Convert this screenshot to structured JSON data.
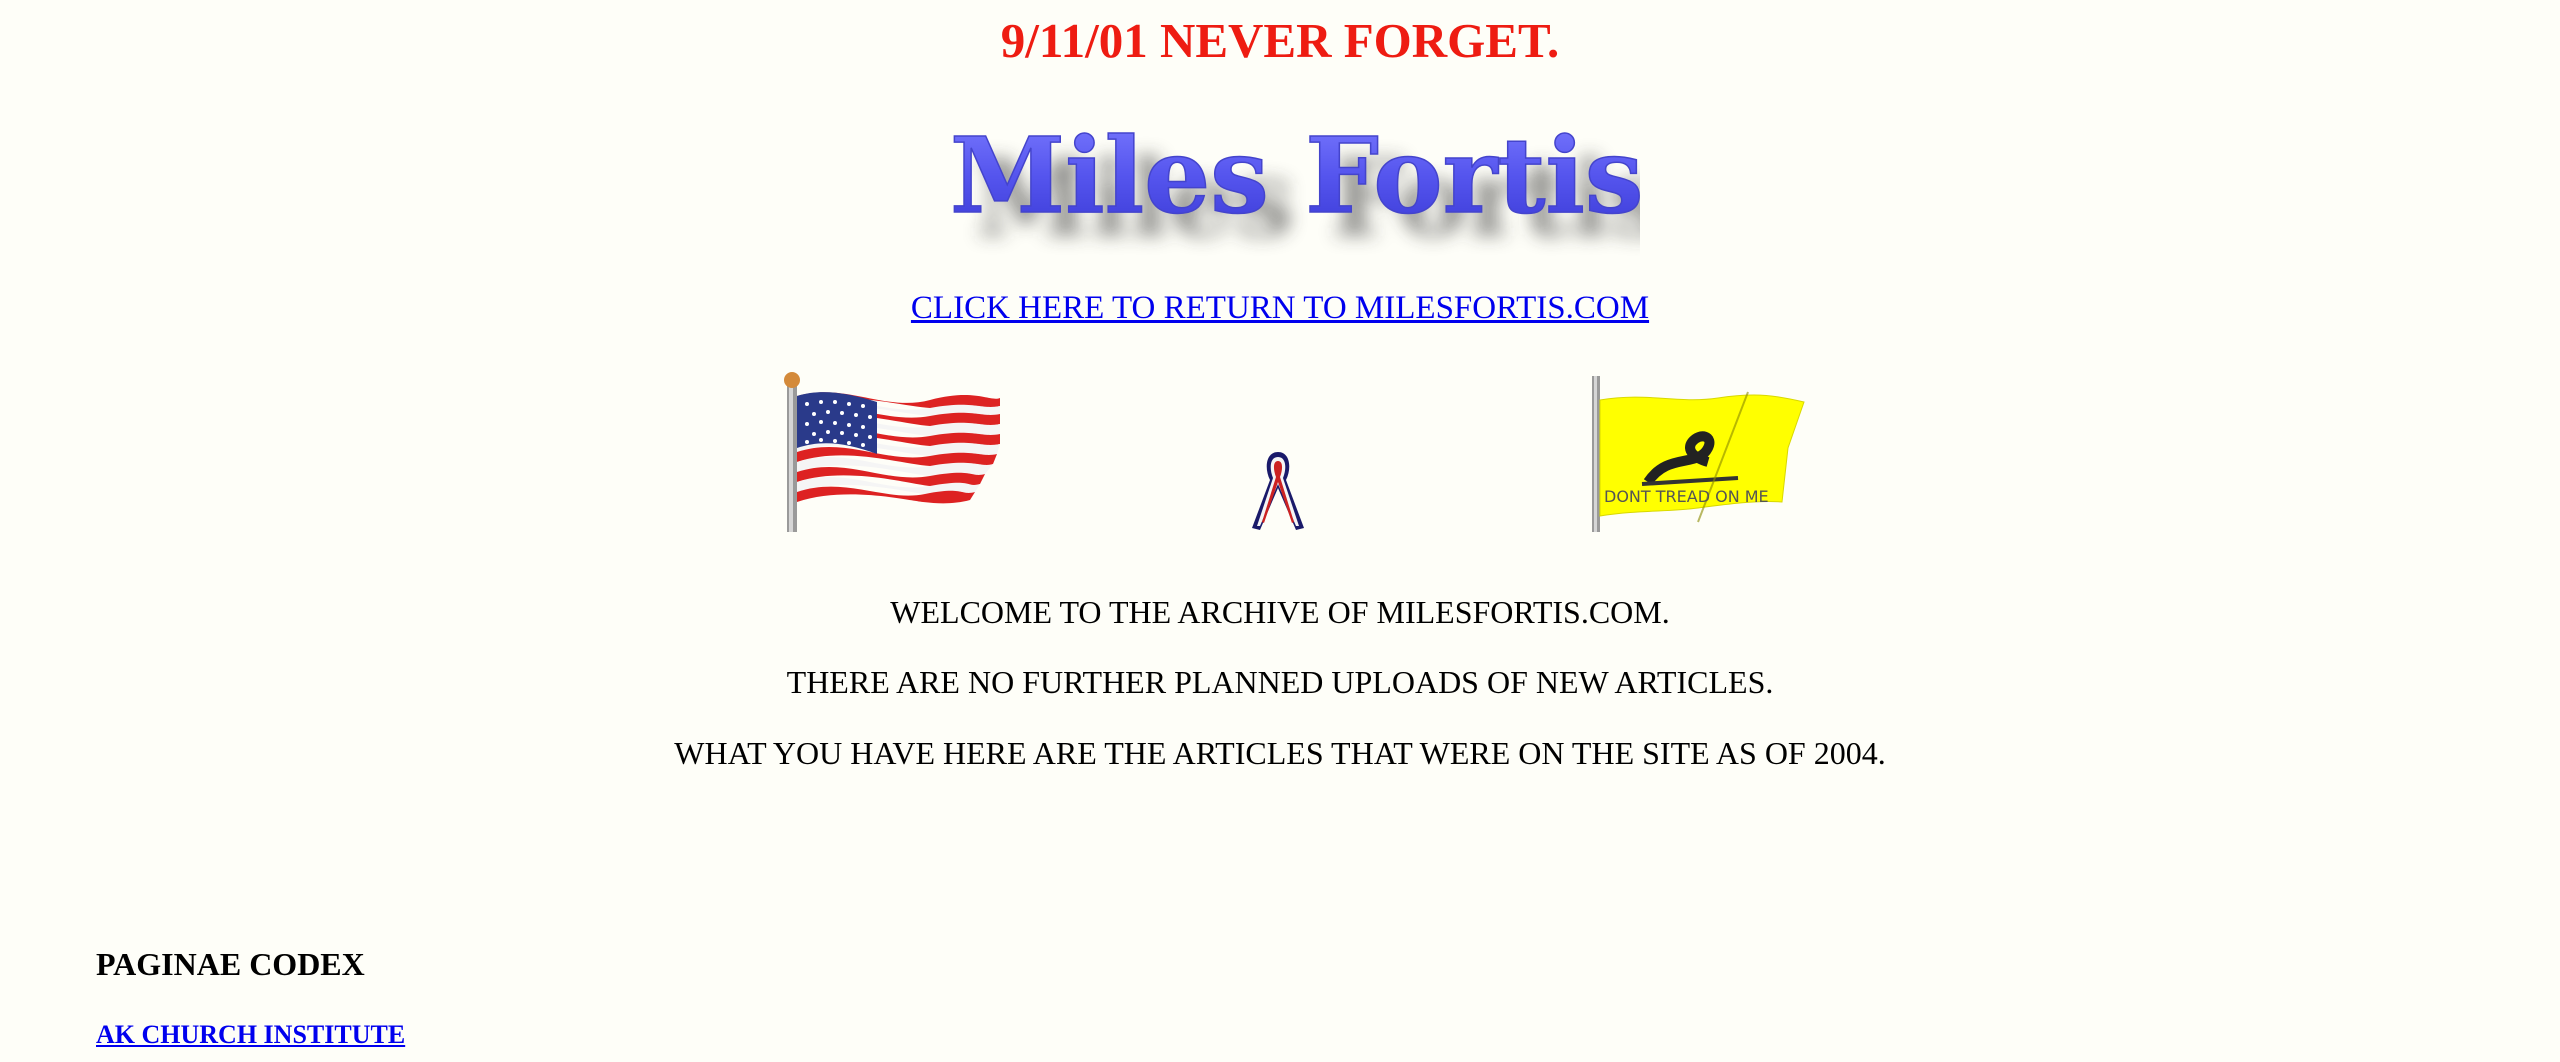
{
  "header": {
    "memorial_title": "9/11/01 NEVER FORGET.",
    "logo_text": "Miles Fortis",
    "return_link": "CLICK HERE TO RETURN TO MILESFORTIS.COM"
  },
  "images": {
    "us_flag": "american-flag-icon",
    "ribbon": "red-white-blue-ribbon-icon",
    "gadsden_flag": "gadsden-flag-icon",
    "gadsden_flag_text": "DONT TREAD ON ME"
  },
  "welcome": {
    "line1": "WELCOME TO THE ARCHIVE OF MILESFORTIS.COM.",
    "line2": "THERE ARE NO FURTHER PLANNED UPLOADS OF NEW ARTICLES.",
    "line3": "WHAT YOU HAVE HERE ARE THE ARTICLES THAT WERE ON THE SITE AS OF 2004."
  },
  "sections": {
    "heading": "PAGINAE CODEX",
    "links": [
      "AK CHURCH INSTITUTE"
    ]
  },
  "colors": {
    "background": "#fefef8",
    "memorial_red": "#ee1c12",
    "link_blue": "#0000ee",
    "logo_blue": "#5555ee",
    "flag_yellow": "#ffff00"
  }
}
